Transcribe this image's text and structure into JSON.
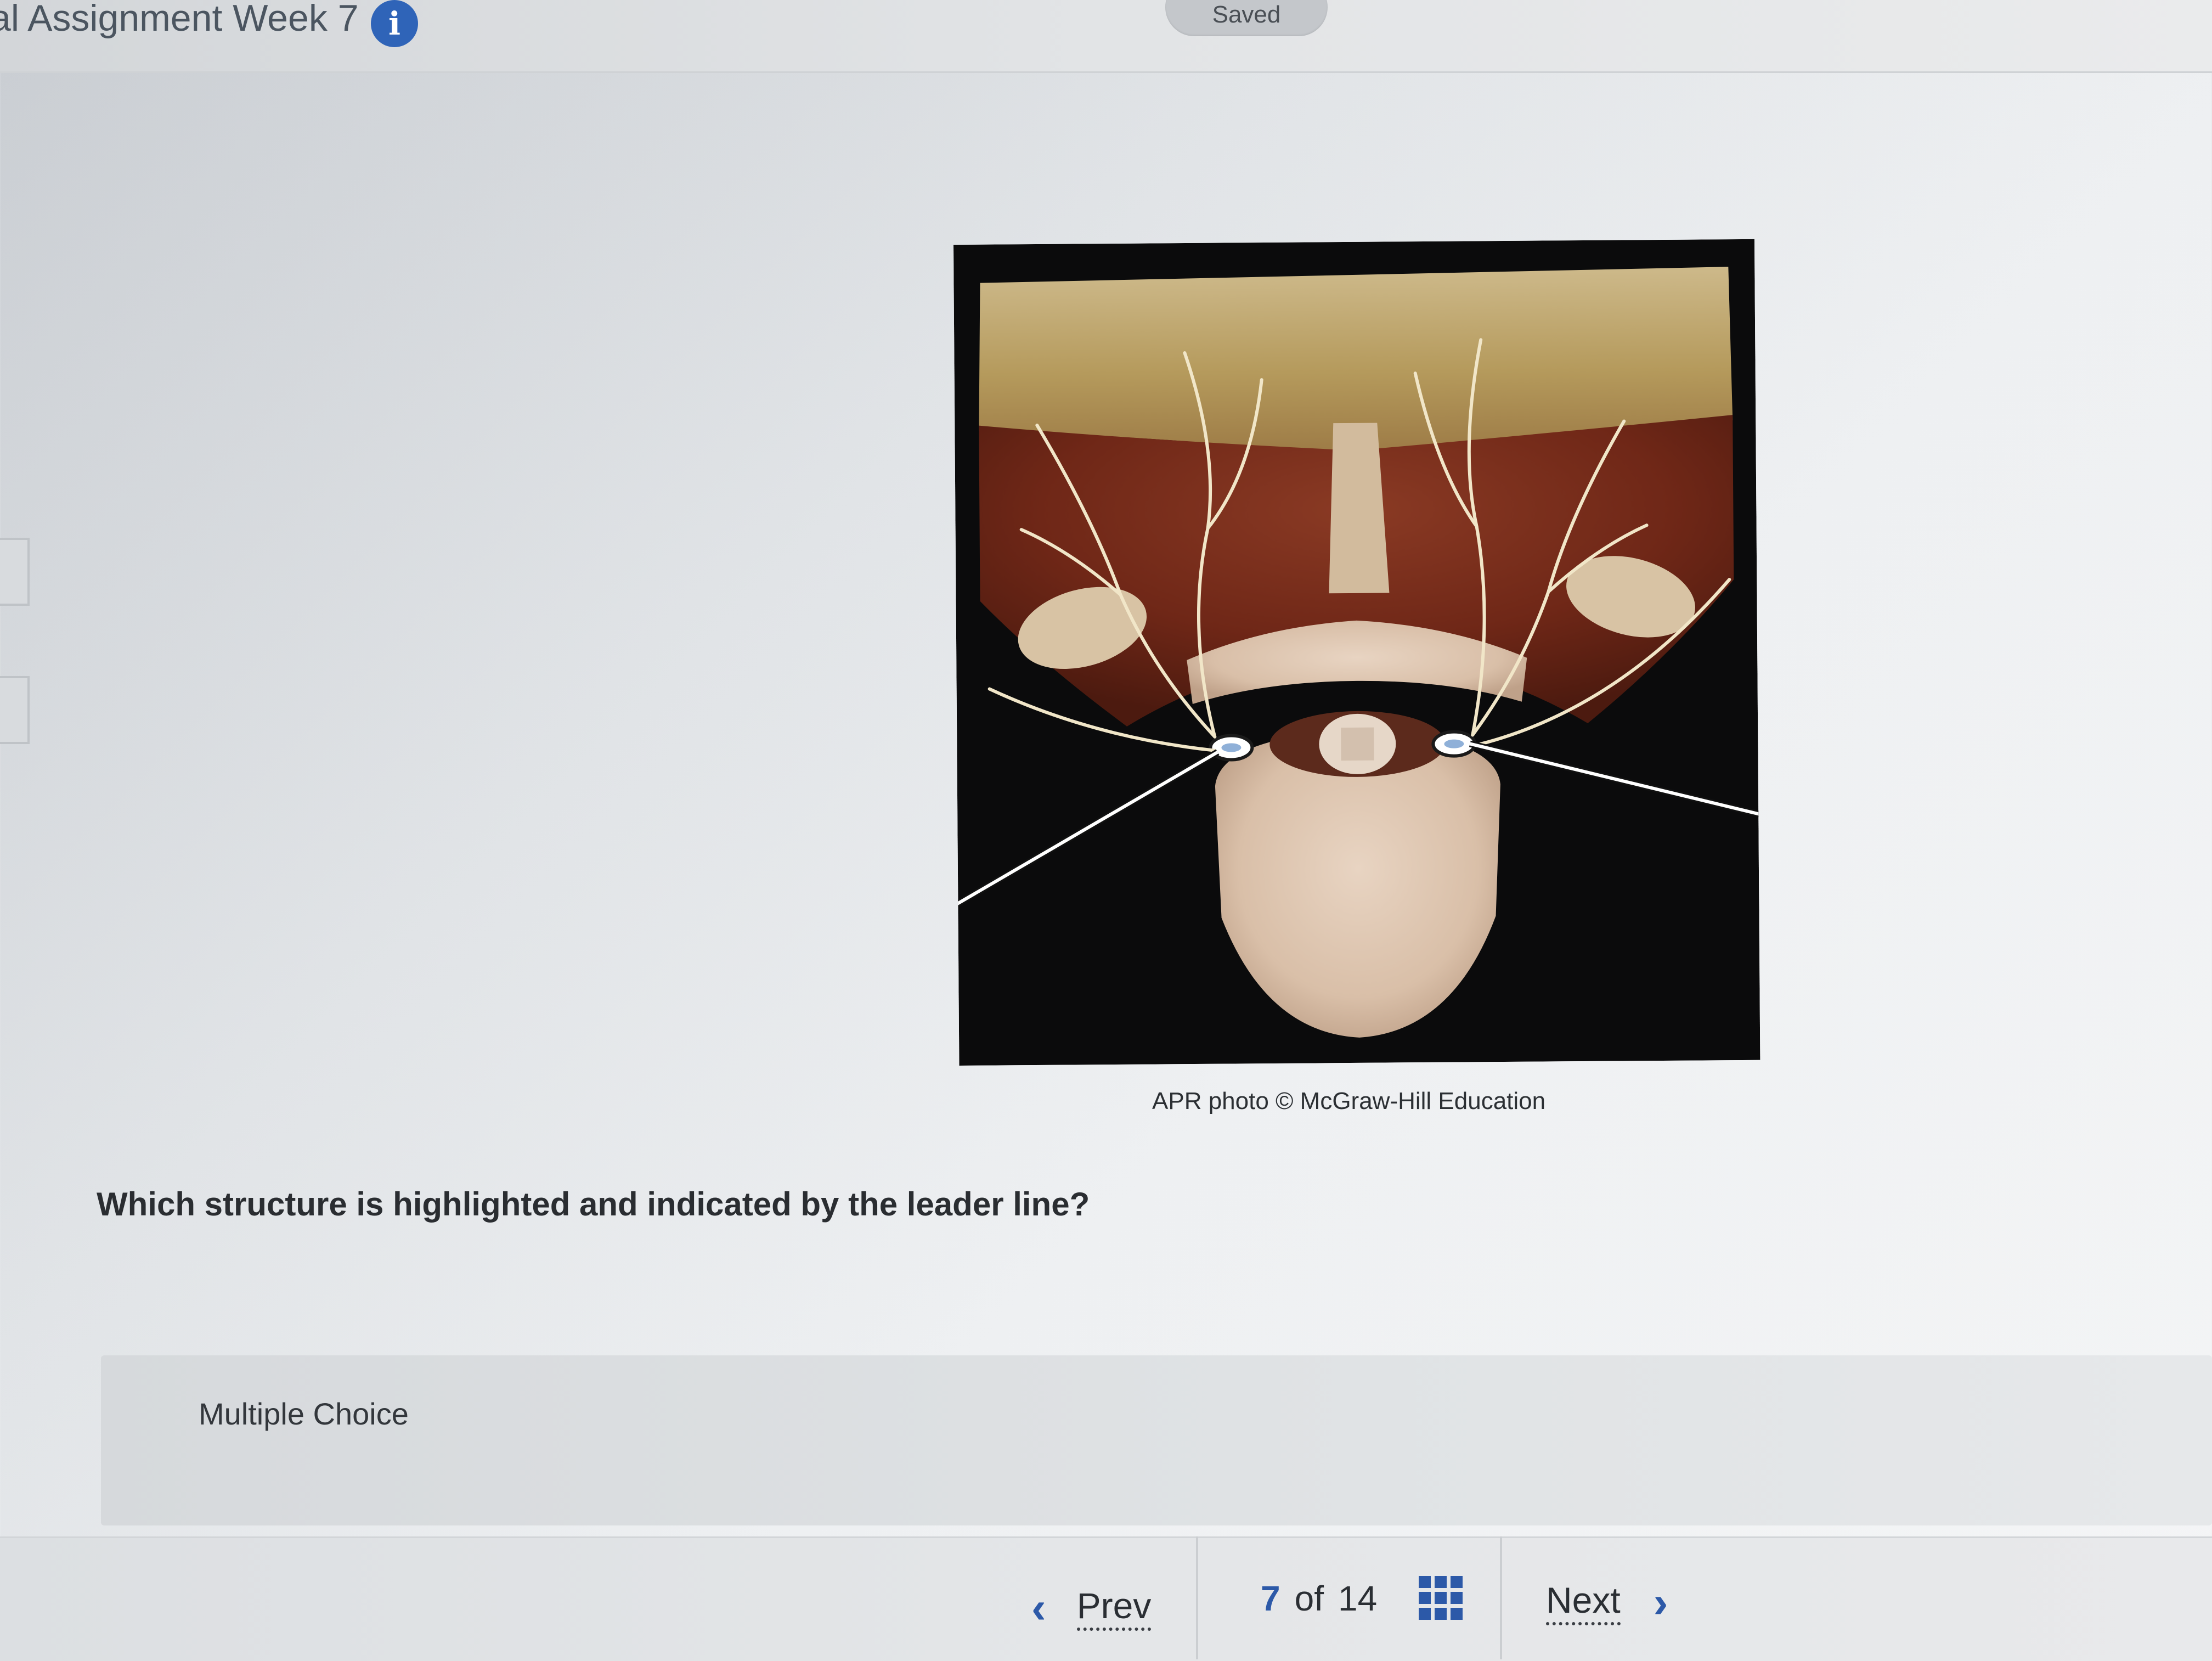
{
  "header": {
    "assignment_title": "al Assignment Week 7",
    "info_icon": "info-icon",
    "save_status": "Saved"
  },
  "figure": {
    "credit": "APR photo © McGraw-Hill Education"
  },
  "question": {
    "text": "Which structure is highlighted and indicated by the leader line?",
    "type_label": "Multiple Choice"
  },
  "navigation": {
    "prev_label": "Prev",
    "next_label": "Next",
    "current_page": "7",
    "separator": "of",
    "total_pages": "14",
    "prev_icon": "chevron-left-icon",
    "next_icon": "chevron-right-icon",
    "overview_icon": "grid-icon"
  },
  "colors": {
    "accent": "#2c59a8",
    "info_badge": "#2f64b8"
  }
}
